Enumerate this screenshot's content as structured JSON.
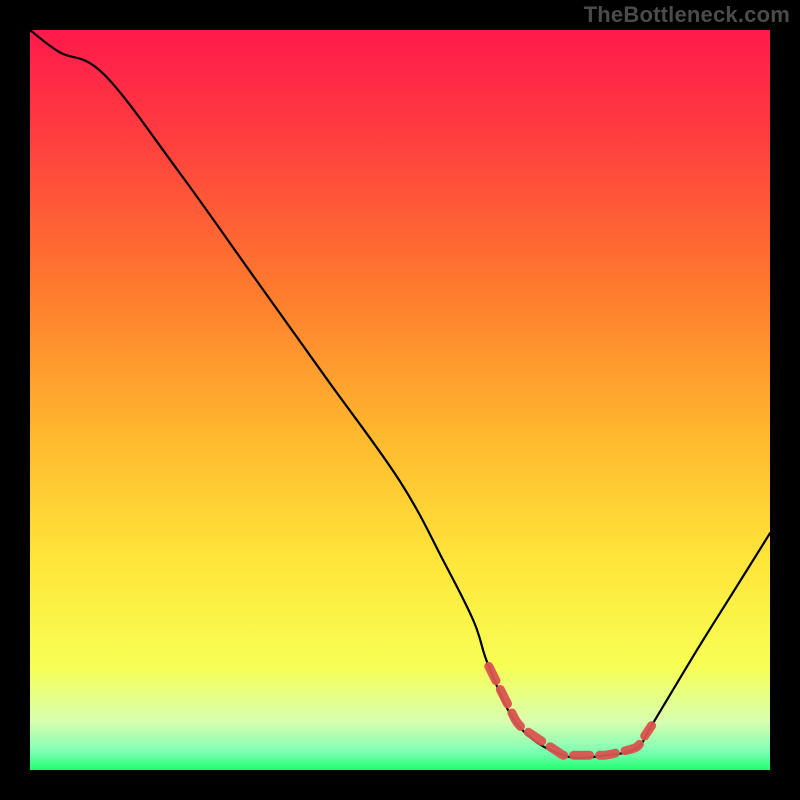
{
  "watermark": "TheBottleneck.com",
  "colors": {
    "background": "#000000",
    "watermark_text": "#4b4b4b",
    "curve": "#000000",
    "marker_stroke": "#d9534f",
    "marker_fill": "#d9534f",
    "gradient_stops": [
      {
        "offset": 0.0,
        "color": "#ff1a4b"
      },
      {
        "offset": 0.15,
        "color": "#ff3f3f"
      },
      {
        "offset": 0.35,
        "color": "#ff7a2e"
      },
      {
        "offset": 0.55,
        "color": "#ffb92e"
      },
      {
        "offset": 0.72,
        "color": "#ffe63a"
      },
      {
        "offset": 0.86,
        "color": "#f7ff54"
      },
      {
        "offset": 0.935,
        "color": "#d8ffb0"
      },
      {
        "offset": 0.975,
        "color": "#7dffb3"
      },
      {
        "offset": 1.0,
        "color": "#1fff6e"
      }
    ]
  },
  "chart_data": {
    "type": "line",
    "title": "",
    "xlabel": "",
    "ylabel": "",
    "xlim": [
      0,
      100
    ],
    "ylim": [
      0,
      100
    ],
    "x": [
      0,
      4,
      10,
      20,
      30,
      40,
      50,
      56,
      60,
      62,
      66,
      72,
      78,
      82,
      84,
      90,
      95,
      100
    ],
    "values": [
      100,
      97,
      94,
      81,
      67,
      53,
      39,
      28,
      20,
      14,
      6,
      2,
      2,
      3,
      6,
      16,
      24,
      32
    ],
    "marker_region": {
      "x_start": 62,
      "x_end": 84
    },
    "annotations": []
  }
}
